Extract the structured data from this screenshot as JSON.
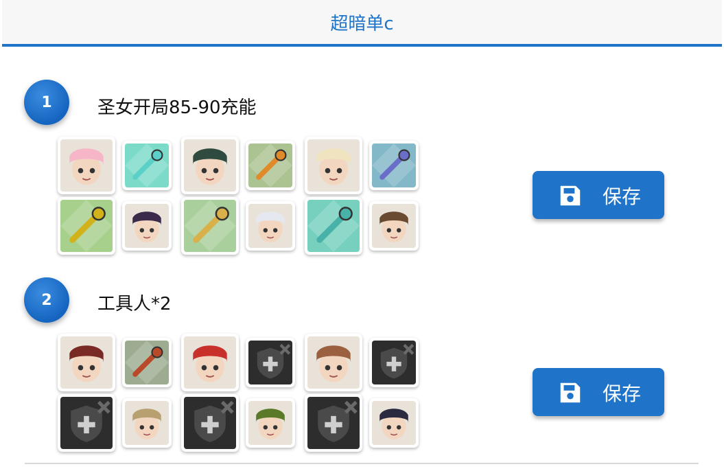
{
  "header": {
    "title": "超暗单c"
  },
  "teams": [
    {
      "number": "1",
      "name": "圣女开局85-90充能",
      "save_label": "保存",
      "slots": [
        {
          "kind": "hero",
          "icon": "hero-pink-hair-priestess-portrait",
          "color": "#f6b6c8"
        },
        {
          "kind": "item",
          "icon": "crystal-sword-icon",
          "color": "#5ad0c8"
        },
        {
          "kind": "hero",
          "icon": "hero-dark-green-hair-girl-portrait",
          "color": "#2f4a3e"
        },
        {
          "kind": "item",
          "icon": "orange-mace-staff-icon",
          "color": "#e08a2a"
        },
        {
          "kind": "hero",
          "icon": "hero-white-fox-dragon-portrait",
          "color": "#f0e3c0"
        },
        {
          "kind": "item",
          "icon": "purple-orb-icon",
          "color": "#6a6ec8"
        },
        {
          "kind": "item",
          "icon": "golden-tome-icon",
          "color": "#d1b21a"
        },
        {
          "kind": "hero",
          "icon": "hero-purple-hair-man-portrait",
          "color": "#3c2a4a"
        },
        {
          "kind": "item",
          "icon": "golden-bow-icon",
          "color": "#d9b04a"
        },
        {
          "kind": "hero",
          "icon": "hero-white-hair-girl-portrait",
          "color": "#e6e8f0"
        },
        {
          "kind": "item",
          "icon": "teal-wand-icon",
          "color": "#48b2a8"
        },
        {
          "kind": "hero",
          "icon": "hero-glasses-goggles-boy-portrait",
          "color": "#6a4a30"
        }
      ]
    },
    {
      "number": "2",
      "name": "工具人*2",
      "save_label": "保存",
      "slots": [
        {
          "kind": "hero",
          "icon": "hero-red-scarf-ninja-portrait",
          "color": "#7a2a24"
        },
        {
          "kind": "item",
          "icon": "red-gem-scepter-icon",
          "color": "#b84a2a"
        },
        {
          "kind": "hero",
          "icon": "hero-red-hair-boy-portrait",
          "color": "#c8302a"
        },
        {
          "kind": "empty",
          "icon": "empty-slot-shield-plus-icon",
          "color": "#3a3a3a"
        },
        {
          "kind": "hero",
          "icon": "hero-brown-hair-boy-wink-portrait",
          "color": "#9a6040"
        },
        {
          "kind": "empty",
          "icon": "empty-slot-shield-plus-icon",
          "color": "#3a3a3a"
        },
        {
          "kind": "empty",
          "icon": "empty-slot-shield-plus-icon",
          "color": "#3a3a3a"
        },
        {
          "kind": "hero",
          "icon": "hero-owl-portrait",
          "color": "#b8a070"
        },
        {
          "kind": "empty",
          "icon": "empty-slot-shield-plus-icon",
          "color": "#3a3a3a"
        },
        {
          "kind": "hero",
          "icon": "hero-skull-king-portrait",
          "color": "#5a7a2a"
        },
        {
          "kind": "empty",
          "icon": "empty-slot-shield-plus-icon",
          "color": "#3a3a3a"
        },
        {
          "kind": "hero",
          "icon": "hero-dark-robot-maid-portrait",
          "color": "#2a2a40"
        }
      ]
    }
  ],
  "colors": {
    "accent": "#1f74c9",
    "header_bg": "#f7f7f7"
  }
}
